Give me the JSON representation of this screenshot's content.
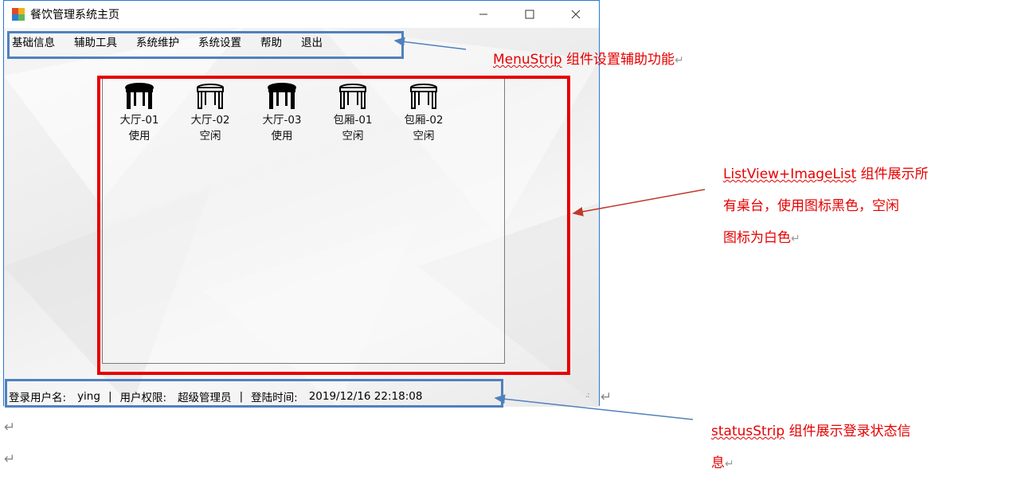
{
  "window": {
    "title": "餐饮管理系统主页"
  },
  "window_controls": {
    "minimize": "—",
    "maximize": "☐",
    "close": "✕"
  },
  "menu": {
    "items": [
      "基础信息",
      "辅助工具",
      "系统维护",
      "系统设置",
      "帮助",
      "退出"
    ]
  },
  "tables": [
    {
      "name": "大厅-01",
      "state": "使用",
      "icon": "table-icon-black"
    },
    {
      "name": "大厅-02",
      "state": "空闲",
      "icon": "table-icon-white"
    },
    {
      "name": "大厅-03",
      "state": "使用",
      "icon": "table-icon-black"
    },
    {
      "name": "包厢-01",
      "state": "空闲",
      "icon": "table-icon-white"
    },
    {
      "name": "包厢-02",
      "state": "空闲",
      "icon": "table-icon-white"
    }
  ],
  "status": {
    "user_label": "登录用户名:",
    "user_value": "ying",
    "sep": "|",
    "role_label": "用户权限:",
    "role_value": "超级管理员",
    "time_label": "登陆时间:",
    "time_value": "2019/12/16 22:18:08",
    "grip": ".:"
  },
  "annotations": {
    "menu": {
      "term": "MenuStrip",
      "text": " 组件设置辅助功能"
    },
    "listview": {
      "term": "ListView+ImageList",
      "text1": " 组件展示所",
      "text2": "有桌台，使用图标黑色，空闲",
      "text3": "图标为白色"
    },
    "status": {
      "term": "statusStrip",
      "text1": " 组件展示登录状态信",
      "text2": "息"
    }
  },
  "paragraph_mark": "↵",
  "colors": {
    "annotation_red": "#e60000",
    "annotation_blue": "#4f81bd",
    "window_border": "#2b78d4",
    "in_use_table": "#000000",
    "free_table": "#ffffff"
  }
}
